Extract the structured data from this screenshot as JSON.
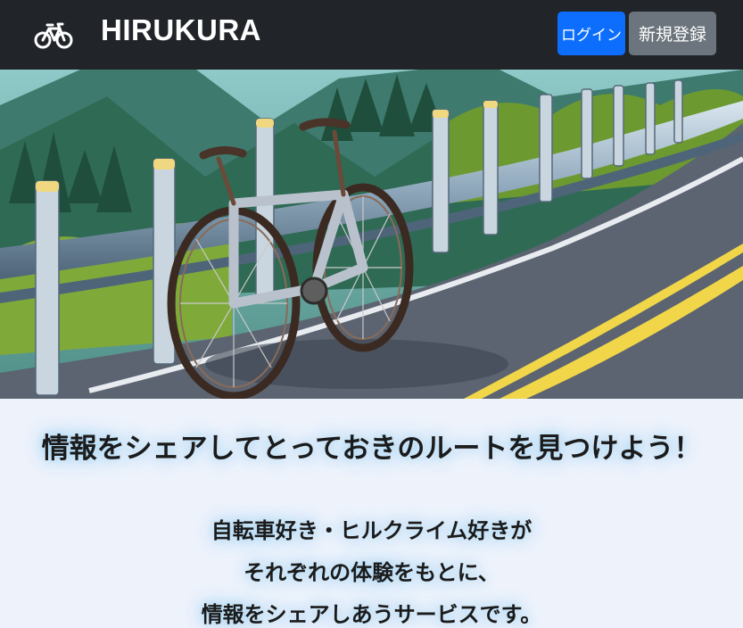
{
  "nav": {
    "brand": "HIRUKURA",
    "brand_icon": "bicycle-icon",
    "login_label": "ログイン",
    "signup_label": "新規登録"
  },
  "hero": {
    "image": "road-bicycle-illustration"
  },
  "intro": {
    "headline": "情報をシェアしてとっておきのルートを見つけよう！",
    "lines": [
      "自転車好き・ヒルクライム好きが",
      "それぞれの体験をもとに、",
      "情報をシェアしあうサービスです。"
    ]
  },
  "colors": {
    "navbar": "#212529",
    "login_button": "#0d6efd",
    "signup_button": "#6c757d",
    "page_background": "#eef2fb"
  }
}
